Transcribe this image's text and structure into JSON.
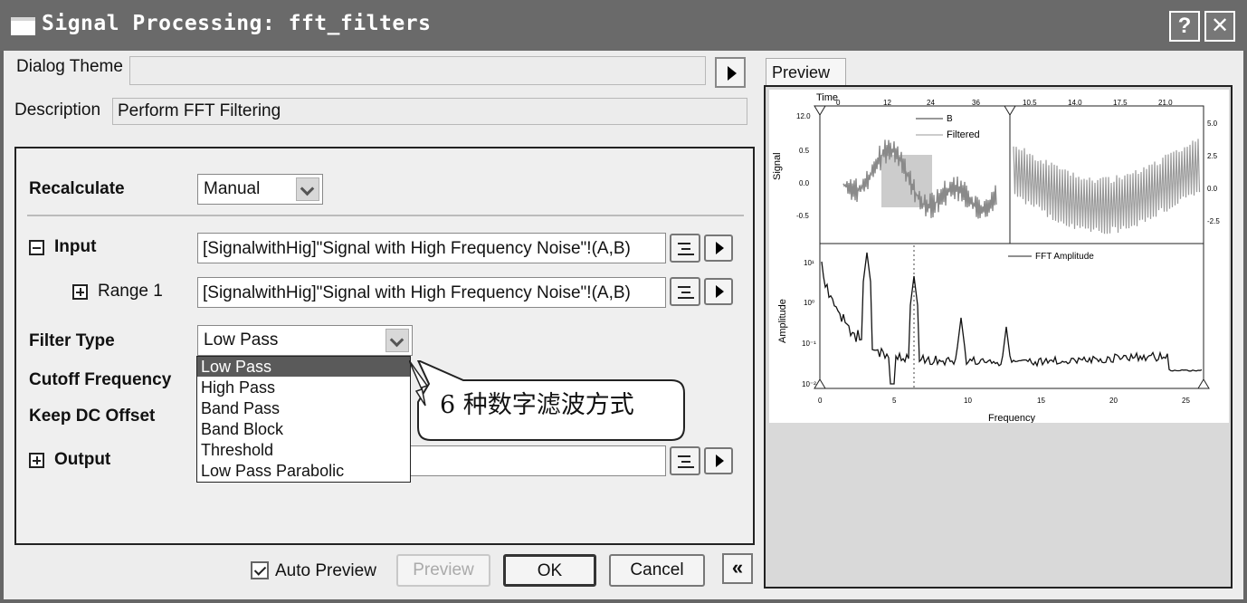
{
  "window": {
    "title": "Signal Processing: fft_filters",
    "help_label": "?",
    "close_label": "✕"
  },
  "dialog_theme": {
    "label": "Dialog Theme",
    "value": ""
  },
  "description": {
    "label": "Description",
    "value": "Perform FFT Filtering"
  },
  "recalculate": {
    "label": "Recalculate",
    "value": "Manual"
  },
  "input": {
    "label": "Input",
    "value": "[SignalwithHig]\"Signal with High Frequency Noise\"!(A,B)",
    "range": {
      "label": "Range 1",
      "value": "[SignalwithHig]\"Signal with High Frequency Noise\"!(A,B)"
    }
  },
  "filter_type": {
    "label": "Filter Type",
    "value": "Low Pass",
    "options": [
      "Low Pass",
      "High Pass",
      "Band Pass",
      "Band Block",
      "Threshold",
      "Low Pass Parabolic"
    ],
    "selected_index": 0
  },
  "cutoff_frequency": {
    "label": "Cutoff Frequency"
  },
  "keep_dc_offset": {
    "label": "Keep DC Offset"
  },
  "output": {
    "label": "Output",
    "value": ""
  },
  "callout": {
    "text": "6 种数字滤波方式"
  },
  "footer": {
    "auto_preview_label": "Auto Preview",
    "auto_preview_checked": true,
    "preview_label": "Preview",
    "ok_label": "OK",
    "cancel_label": "Cancel",
    "collapse_label": "«"
  },
  "preview": {
    "tab_label": "Preview",
    "top_plot": {
      "top_axis_label": "Time",
      "top_ticks_left": [
        "0",
        "12",
        "24",
        "36"
      ],
      "top_ticks_right": [
        "10.5",
        "14.0",
        "17.5",
        "21.0"
      ],
      "ylabel": "Signal",
      "left_yticks": [
        "12.0",
        "0.5",
        "0.0",
        "-0.5"
      ],
      "right_yticks": [
        "5.0",
        "2.5",
        "0.0",
        "-2.5"
      ],
      "legend": [
        "B",
        "Filtered"
      ]
    },
    "bottom_plot": {
      "ylabel": "Amplitude",
      "xlabel": "Frequency",
      "xticks": [
        "0",
        "5",
        "10",
        "15",
        "20",
        "25"
      ],
      "yticks": [
        "10¹",
        "10⁰",
        "10⁻¹",
        "10⁻²"
      ],
      "legend": [
        "FFT Amplitude"
      ]
    }
  }
}
